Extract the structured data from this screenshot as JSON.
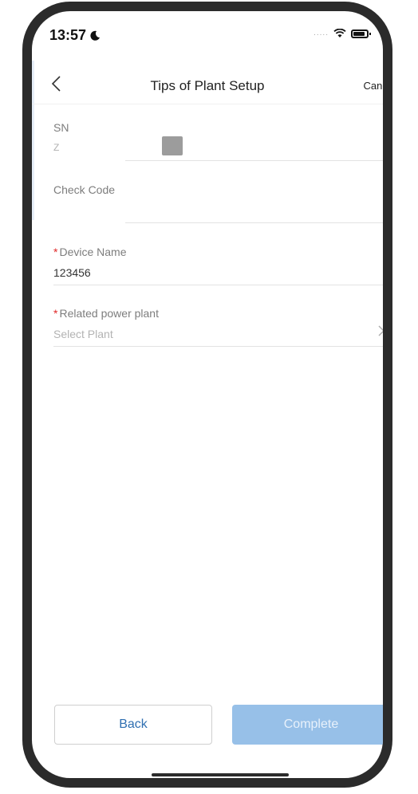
{
  "status": {
    "time": "13:57",
    "signal_dots": ".....",
    "icons": [
      "moon-icon",
      "wifi-icon",
      "battery-icon"
    ]
  },
  "nav": {
    "back_icon": "chevron-left-icon",
    "title": "Tips of Plant Setup",
    "cancel": "Cancel"
  },
  "form": {
    "sn": {
      "label": "SN",
      "value": "Z"
    },
    "check_code": {
      "label": "Check Code",
      "value": ""
    },
    "device_name": {
      "label": "Device Name",
      "required_mark": "*",
      "value": "123456"
    },
    "plant": {
      "label": "Related power plant",
      "required_mark": "*",
      "placeholder": "Select Plant",
      "icon": "chevron-right-icon"
    }
  },
  "buttons": {
    "back": "Back",
    "complete": "Complete"
  },
  "colors": {
    "accent": "#2f6fb1",
    "complete_button": "#97c0e8",
    "required": "#e02828"
  }
}
